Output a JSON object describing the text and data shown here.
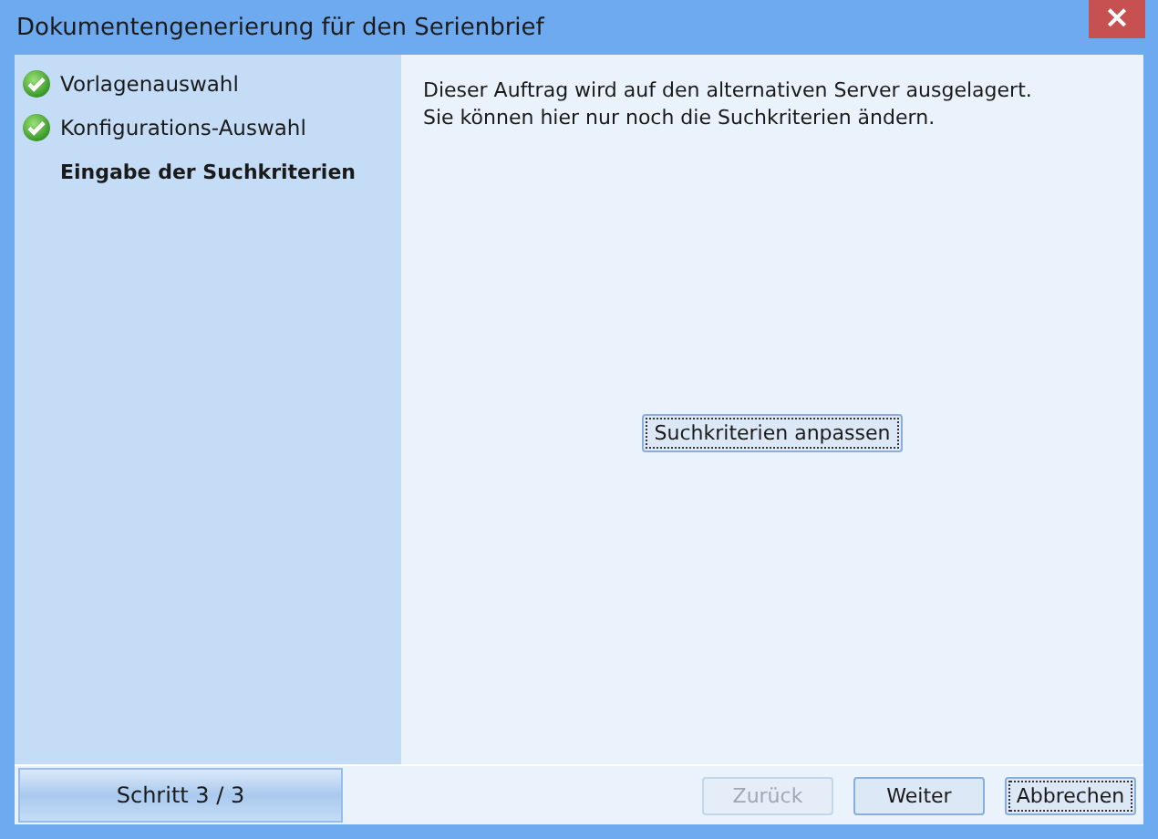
{
  "window": {
    "title": "Dokumentengenerierung für den Serienbrief",
    "close": "×"
  },
  "steps": [
    {
      "label": "Vorlagenauswahl",
      "done": true,
      "selected": false
    },
    {
      "label": "Konfigurations-Auswahl",
      "done": true,
      "selected": false
    },
    {
      "label": "Eingabe der Suchkriterien",
      "done": false,
      "selected": true
    }
  ],
  "message": [
    "Dieser Auftrag wird auf den alternativen Server ausgelagert.",
    "Sie können hier nur noch die Suchkriterien ändern."
  ],
  "action_button": {
    "label": "Suchkriterien anpassen",
    "focused": true
  },
  "step_indicator": "Schritt 3 / 3",
  "buttons": [
    {
      "label": "Zurück",
      "disabled": true,
      "focused": false
    },
    {
      "label": "Weiter",
      "disabled": false,
      "focused": false
    },
    {
      "label": "Abbrechen",
      "disabled": false,
      "focused": true
    }
  ]
}
